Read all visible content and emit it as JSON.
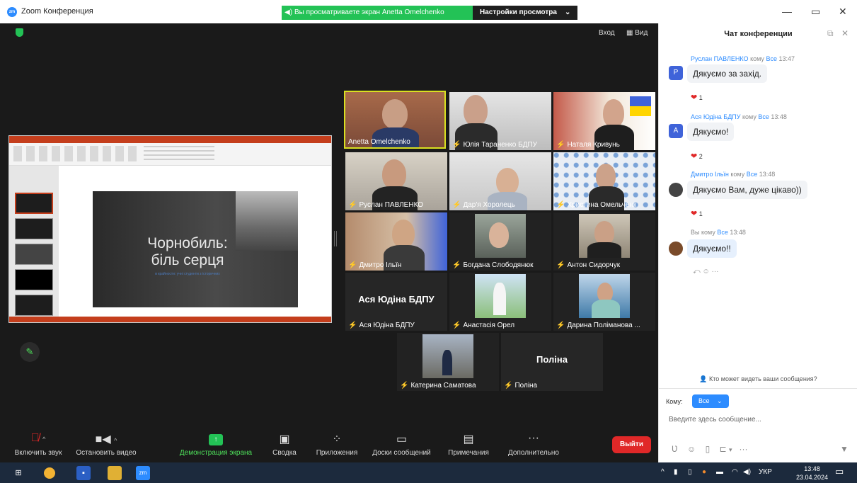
{
  "window": {
    "title": "Zoom Конференция",
    "logo": "zm"
  },
  "banner": {
    "sharing_text": "Вы просматриваете экран Anetta Omelchenko",
    "view_options": "Настройки просмотра"
  },
  "top_right": {
    "enter": "Вход",
    "view": "Вид"
  },
  "slide": {
    "title": "Чорнобиль: біль серця",
    "subtitle": "в крайности: учні студенти з історичних"
  },
  "participants": [
    {
      "name": "Anetta Omelchenko",
      "muted": false,
      "active": true
    },
    {
      "name": "Юлія Тараненко БДПУ",
      "muted": true
    },
    {
      "name": "Наталя Кривунь",
      "muted": true
    },
    {
      "name": "Руслан ПАВЛЕНКО",
      "muted": true
    },
    {
      "name": "Дар'я Хоролець",
      "muted": true
    },
    {
      "name": "Христина Омельченк",
      "muted": true
    },
    {
      "name": "Дмитро Ільїн",
      "muted": true
    },
    {
      "name": "Богдана Слободянюк",
      "muted": true
    },
    {
      "name": "Антон Сидорчук",
      "muted": true
    },
    {
      "name": "Ася Юдіна БДПУ",
      "muted": true,
      "video_off_label": "Ася Юдіна БДПУ"
    },
    {
      "name": "Анастасія Орел",
      "muted": true
    },
    {
      "name": "Дарина Поліманова ...",
      "muted": true
    },
    {
      "name": "Катерина Саматова",
      "muted": true
    },
    {
      "name": "Поліна",
      "muted": true,
      "video_off_label": "Поліна"
    }
  ],
  "toolbar": {
    "unmute": "Включить звук",
    "stop_video": "Остановить видео",
    "share": "Демонстрация экрана",
    "summary": "Сводка",
    "apps": "Приложения",
    "whiteboards": "Доски сообщений",
    "notes": "Примечания",
    "more": "Дополнительно",
    "leave": "Выйти"
  },
  "chat": {
    "header": "Чат конференции",
    "messages": [
      {
        "sender": "Руслан ПАВЛЕНКО",
        "to_word": "кому",
        "to": "Все",
        "time": "13:47",
        "text": "Дякуємо за захід.",
        "avatar": "Р",
        "avatar_color": "#3f63d9",
        "reaction_count": "1"
      },
      {
        "sender": "Ася Юдіна БДПУ",
        "to_word": "кому",
        "to": "Все",
        "time": "13:48",
        "text": "Дякуємо!",
        "avatar": "А",
        "avatar_color": "#3f63d9",
        "reaction_count": "2"
      },
      {
        "sender": "Дмитро Ільїн",
        "to_word": "кому",
        "to": "Все",
        "time": "13:48",
        "text": "Дякуємо Вам, дуже цікаво))",
        "avatar": "",
        "avatar_color": "#444444",
        "reaction_count": "1"
      },
      {
        "sender": "Вы",
        "to_word": "кому",
        "to": "Все",
        "time": "13:48",
        "text": "Дякуємо!!",
        "avatar": "",
        "avatar_color": "#7a4b2a",
        "reaction_count": ""
      }
    ],
    "who_can_see": "Кто может видеть ваши сообщения?",
    "to_label": "Кому:",
    "to_value": "Все",
    "input_placeholder": "Введите здесь сообщение..."
  },
  "taskbar": {
    "lang": "УКР",
    "time": "13:48",
    "date": "23.04.2024"
  },
  "colors": {
    "zoom_blue": "#2d8cff",
    "sharing_green": "#23c256",
    "leave_red": "#e02828",
    "active_speaker": "#d9e021"
  }
}
